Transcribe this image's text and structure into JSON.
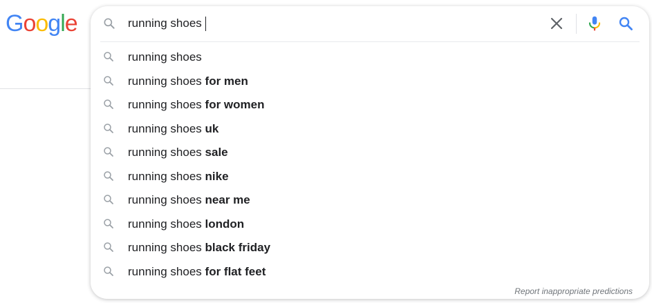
{
  "logo": {
    "letters": [
      "G",
      "o",
      "o",
      "g",
      "l",
      "e"
    ],
    "colors": [
      "#4285F4",
      "#EA4335",
      "#FBBC05",
      "#4285F4",
      "#34A853",
      "#EA4335"
    ]
  },
  "search": {
    "value": "running shoes",
    "icons": {
      "lead": "search-icon",
      "clear": "close-icon",
      "voice": "microphone-icon",
      "submit": "search-icon"
    },
    "accent": "#4285F4"
  },
  "suggestions": [
    {
      "prefix": "running shoes",
      "completion": ""
    },
    {
      "prefix": "running shoes ",
      "completion": "for men"
    },
    {
      "prefix": "running shoes ",
      "completion": "for women"
    },
    {
      "prefix": "running shoes ",
      "completion": "uk"
    },
    {
      "prefix": "running shoes ",
      "completion": "sale"
    },
    {
      "prefix": "running shoes ",
      "completion": "nike"
    },
    {
      "prefix": "running shoes ",
      "completion": "near me"
    },
    {
      "prefix": "running shoes ",
      "completion": "london"
    },
    {
      "prefix": "running shoes ",
      "completion": "black friday"
    },
    {
      "prefix": "running shoes ",
      "completion": "for flat feet"
    }
  ],
  "footer": {
    "report_label": "Report inappropriate predictions"
  }
}
